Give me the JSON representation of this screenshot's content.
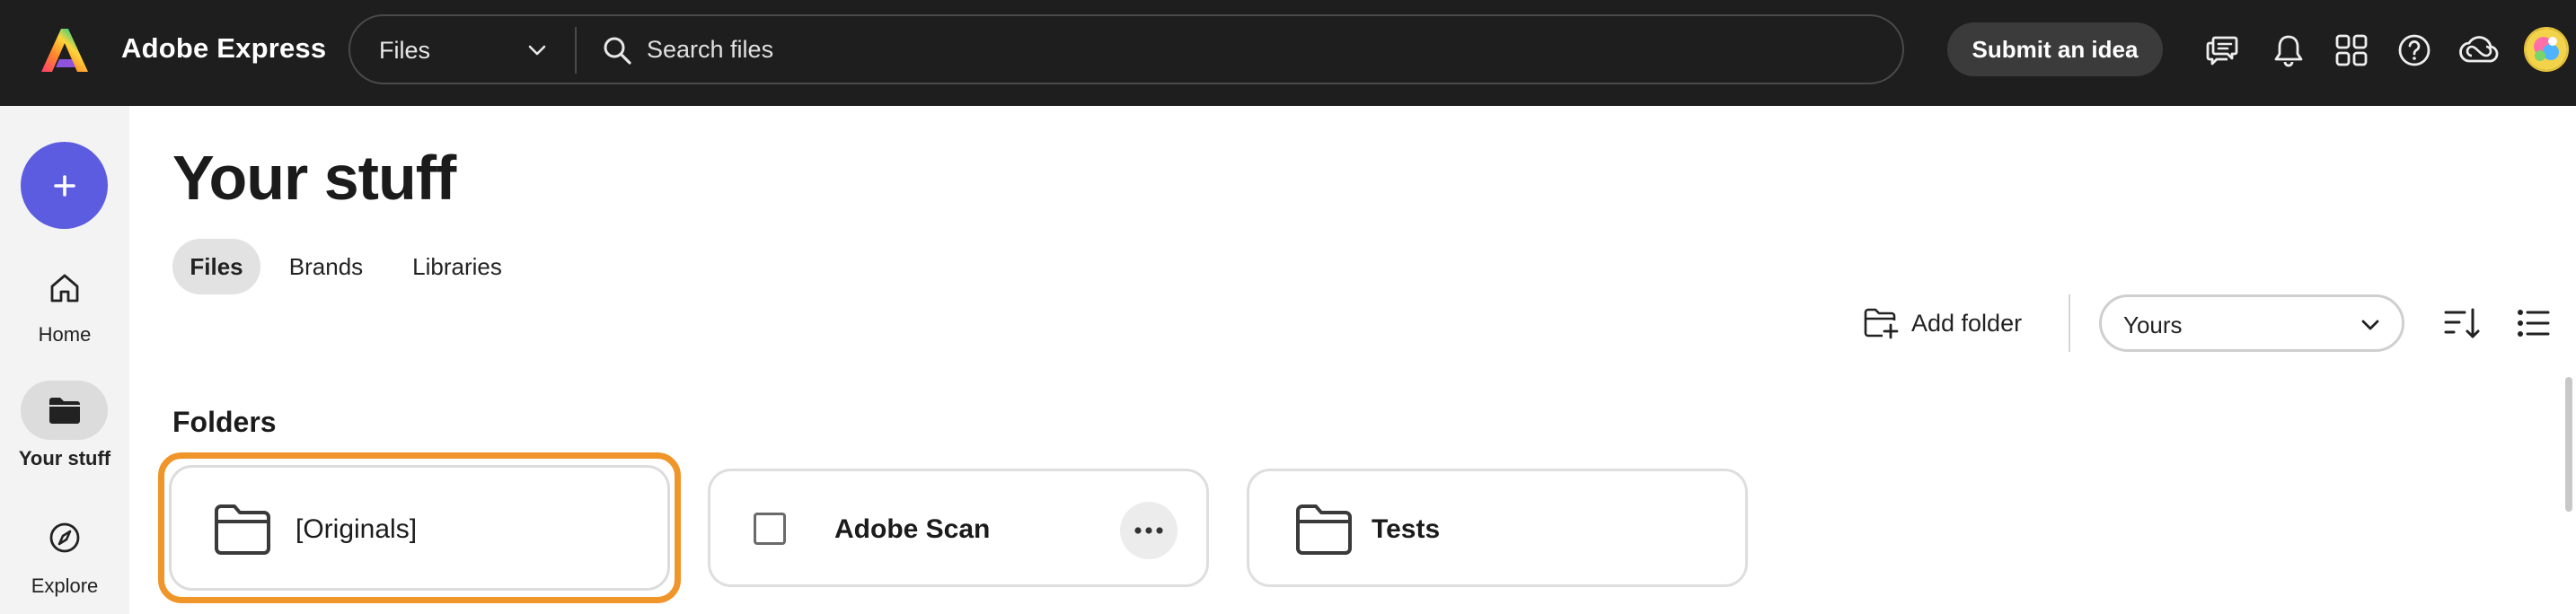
{
  "app": {
    "name": "Adobe Express"
  },
  "search": {
    "scope": "Files",
    "placeholder": "Search files"
  },
  "header": {
    "submit_idea_label": "Submit an idea",
    "icons": [
      "feedback-icon",
      "bell-icon",
      "apps-grid-icon",
      "help-icon",
      "creative-cloud-icon"
    ]
  },
  "rail": {
    "create_icon": "plus-icon",
    "items": [
      {
        "label": "Home",
        "icon": "home-icon"
      },
      {
        "label": "Your stuff",
        "icon": "folder-icon",
        "active": true
      },
      {
        "label": "Explore",
        "icon": "compass-icon"
      }
    ]
  },
  "page": {
    "title": "Your stuff",
    "tabs": [
      {
        "label": "Files",
        "active": true
      },
      {
        "label": "Brands"
      },
      {
        "label": "Libraries"
      }
    ]
  },
  "toolbar": {
    "add_folder_label": "Add folder",
    "owner_filter": "Yours",
    "sort_icon": "sort-descending-icon",
    "view_icon": "list-view-icon"
  },
  "folders_section": {
    "title": "Folders",
    "items": [
      {
        "name": "[Originals]",
        "icon": "folder-icon",
        "selected": true
      },
      {
        "name": "Adobe Scan",
        "icon": "checkbox",
        "hovered": true
      },
      {
        "name": "Tests",
        "icon": "folder-icon"
      }
    ]
  },
  "colors": {
    "topbar_bg": "#1e1e1e",
    "create_button": "#5c5ce0",
    "focus_ring": "#f0952a",
    "rail_bg": "#f3f3f3"
  }
}
